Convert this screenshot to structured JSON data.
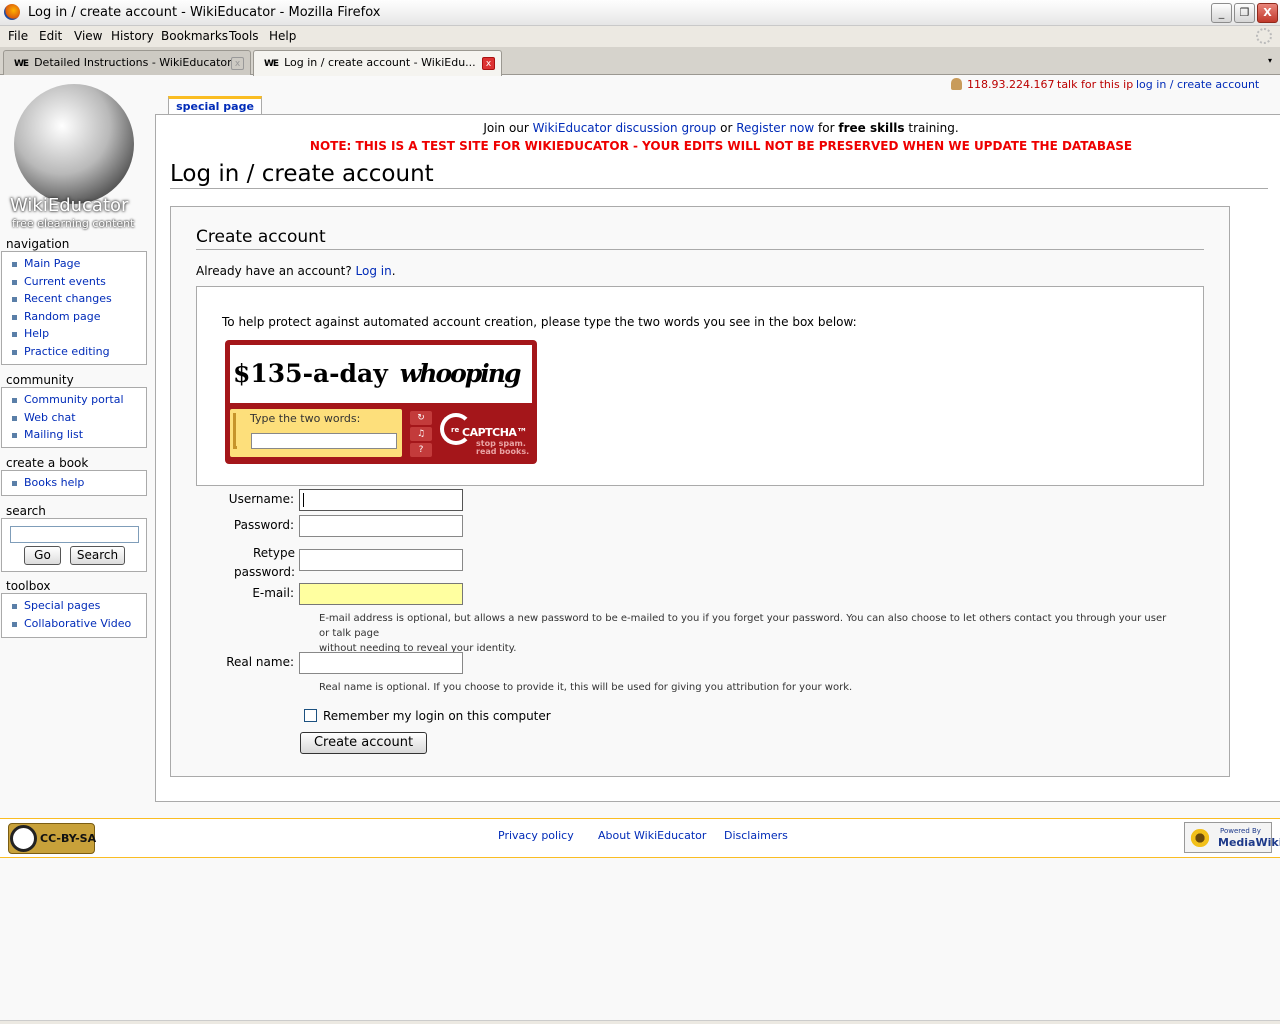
{
  "window": {
    "title": "Log in / create account - WikiEducator - Mozilla Firefox",
    "minimize": "_",
    "restore": "❐",
    "close": "X"
  },
  "menu": [
    "File",
    "Edit",
    "View",
    "History",
    "Bookmarks",
    "Tools",
    "Help"
  ],
  "tabs": [
    {
      "favicon": "WE",
      "label": "Detailed Instructions - WikiEducator",
      "close": "x"
    },
    {
      "favicon": "WE",
      "label": "Log in / create account - WikiEdu...",
      "close": "x"
    }
  ],
  "tabs_menu": "▾",
  "logo": {
    "name": "WikiEducator",
    "tagline": "free elearning content"
  },
  "sidebar": {
    "navigation": {
      "heading": "navigation",
      "items": [
        "Main Page",
        "Current events",
        "Recent changes",
        "Random page",
        "Help",
        "Practice editing"
      ]
    },
    "community": {
      "heading": "community",
      "items": [
        "Community portal",
        "Web chat",
        "Mailing list"
      ]
    },
    "book": {
      "heading": "create a book",
      "items": [
        "Books help"
      ]
    },
    "search": {
      "heading": "search",
      "go": "Go",
      "search": "Search"
    },
    "toolbox": {
      "heading": "toolbox",
      "items": [
        "Special pages",
        "Collaborative Video"
      ]
    }
  },
  "personal": {
    "ip": "118.93.224.167",
    "talk": "talk for this ip",
    "login": "log in / create account"
  },
  "content_tab": "special page",
  "sitenotice": {
    "pre": "Join our ",
    "link1": "WikiEducator discussion group",
    "mid": " or ",
    "link2": "Register now",
    "mid2": " for ",
    "bold": "free skills",
    "post": " training.",
    "note": "NOTE: THIS IS A TEST SITE FOR WIKIEDUCATOR - YOUR EDITS WILL NOT BE PRESERVED WHEN WE UPDATE THE DATABASE"
  },
  "heading": "Log in / create account",
  "form": {
    "title": "Create account",
    "already": "Already have an account?",
    "login_link": "Log in",
    "captcha_intro": "To help protect against automated account creation, please type the two words you see in the box below:",
    "captcha_word1": "$135-a-day",
    "captcha_word2": "whooping",
    "captcha_prompt": "Type the two words:",
    "captcha_reload": "↻",
    "captcha_audio": "♫",
    "captcha_help": "?",
    "recaptcha_re": "re",
    "recaptcha_brand": "CAPTCHA™",
    "recaptcha_tag1": "stop spam.",
    "recaptcha_tag2": "read books.",
    "username_label": "Username:",
    "password_label": "Password:",
    "retype_label_1": "Retype",
    "retype_label_2": "password:",
    "email_label": "E-mail:",
    "email_help_1": "E-mail address is optional, but allows a new password to be e-mailed to you if you forget your password. You can also choose to let others contact you through your user or talk page",
    "email_help_2": "without needing to reveal your identity.",
    "realname_label": "Real name:",
    "realname_help": "Real name is optional. If you choose to provide it, this will be used for giving you attribution for your work.",
    "remember": "Remember my login on this computer",
    "submit": "Create account"
  },
  "footer": {
    "cc": "CC-BY-SA",
    "links": [
      "Privacy policy",
      "About WikiEducator",
      "Disclaimers"
    ],
    "powered": "Powered By",
    "mediawiki": "MediaWiki"
  }
}
